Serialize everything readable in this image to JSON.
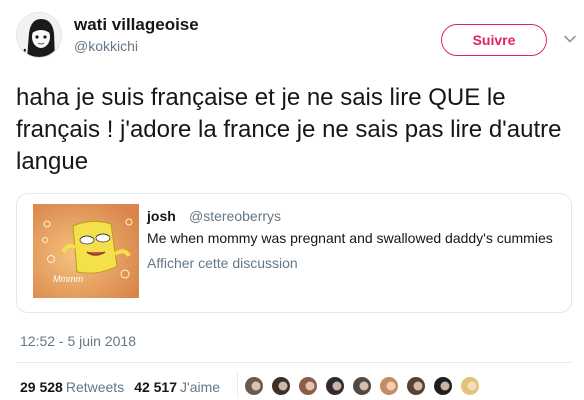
{
  "author": {
    "display_name": "wati villageoise",
    "handle": "@kokkichi"
  },
  "follow_button": {
    "label": "Suivre"
  },
  "tweet": {
    "text": "haha je suis française et je ne sais lire QUE le français ! j'adore la france je ne sais pas lire d'autre langue",
    "timestamp": "12:52 - 5 juin 2018"
  },
  "quote": {
    "author_name": "josh",
    "author_handle": "@stereoberrys",
    "text": "Me when mommy was pregnant and swallowed daddy's cummies",
    "show_thread": "Afficher cette discussion",
    "media_caption": "Mmmm"
  },
  "stats": {
    "retweets_count": "29 528",
    "retweets_label": "Retweets",
    "likes_count": "42 517",
    "likes_label": "J'aime"
  },
  "liker_avatars": [
    {
      "icon": "liker-avatar-1",
      "color": "#6b5a4e"
    },
    {
      "icon": "liker-avatar-2",
      "color": "#3b2f2a"
    },
    {
      "icon": "liker-avatar-3",
      "color": "#8b5e4a"
    },
    {
      "icon": "liker-avatar-4",
      "color": "#2e2a2f"
    },
    {
      "icon": "liker-avatar-5",
      "color": "#4f4a45"
    },
    {
      "icon": "liker-avatar-6",
      "color": "#c48c63"
    },
    {
      "icon": "liker-avatar-7",
      "color": "#5a4033"
    },
    {
      "icon": "liker-avatar-8",
      "color": "#1f1f1f"
    },
    {
      "icon": "liker-avatar-9",
      "color": "#e3c27a"
    }
  ],
  "colors": {
    "follow_accent": "#e0245e",
    "secondary_text": "#657786",
    "border": "#e1e8ed"
  }
}
